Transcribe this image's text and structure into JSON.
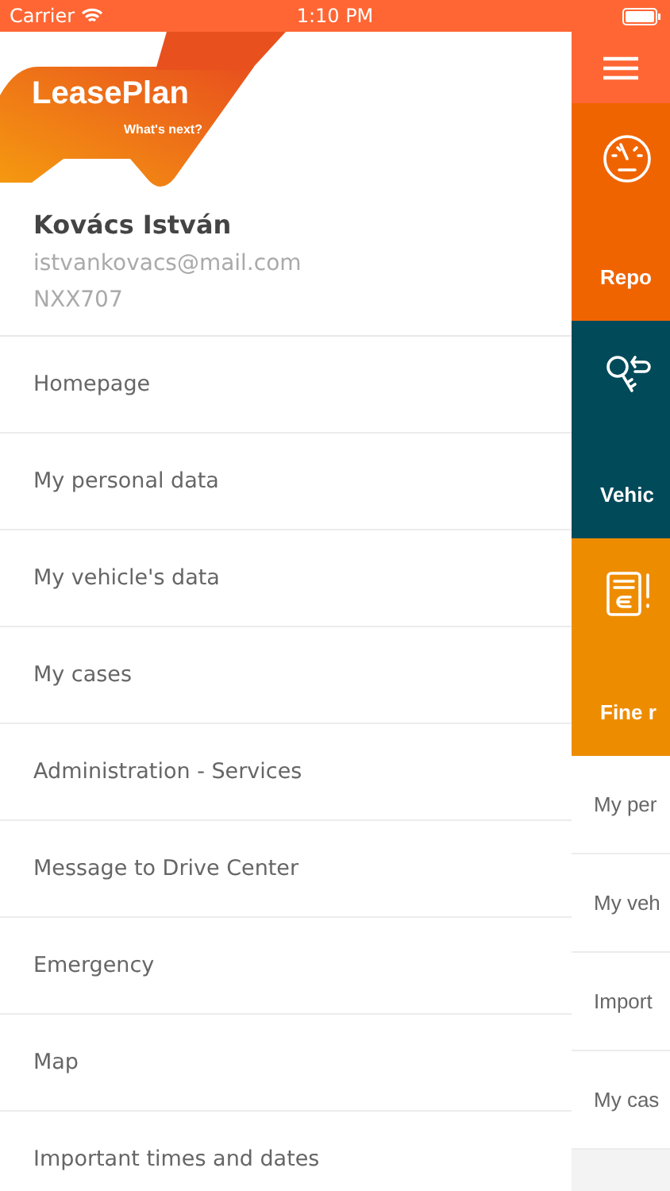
{
  "status_bar": {
    "carrier": "Carrier",
    "time": "1:10 PM"
  },
  "logo": {
    "name": "LeasePlan",
    "tagline": "What's next?"
  },
  "profile": {
    "name": "Kovács István",
    "email": "istvankovacs@mail.com",
    "plate": "NXX707"
  },
  "menu": [
    {
      "label": "Homepage"
    },
    {
      "label": "My personal data"
    },
    {
      "label": "My vehicle's data"
    },
    {
      "label": "My cases"
    },
    {
      "label": "Administration - Services"
    },
    {
      "label": "Message to Drive Center"
    },
    {
      "label": "Emergency"
    },
    {
      "label": "Map"
    },
    {
      "label": "Important times and dates"
    }
  ],
  "tiles": [
    {
      "kind": "gauge",
      "label": "Repo",
      "color": "#f06400"
    },
    {
      "kind": "keys",
      "label": "Vehic",
      "color": "#004a5a"
    },
    {
      "kind": "fine",
      "label": "Fine r",
      "color": "#ee8c00"
    }
  ],
  "shortcuts": [
    {
      "label": "My per"
    },
    {
      "label": "My veh"
    },
    {
      "label": "Import"
    },
    {
      "label": "My cas"
    }
  ]
}
